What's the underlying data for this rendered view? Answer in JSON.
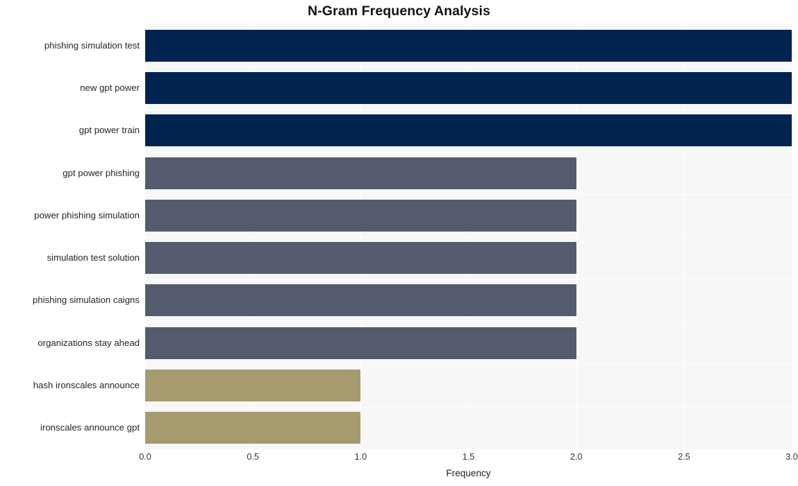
{
  "chart_data": {
    "type": "bar",
    "orientation": "horizontal",
    "title": "N-Gram Frequency Analysis",
    "xlabel": "Frequency",
    "ylabel": "",
    "categories": [
      "phishing simulation test",
      "new gpt power",
      "gpt power train",
      "gpt power phishing",
      "power phishing simulation",
      "simulation test solution",
      "phishing simulation caigns",
      "organizations stay ahead",
      "hash ironscales announce",
      "ironscales announce gpt"
    ],
    "values": [
      3,
      3,
      3,
      2,
      2,
      2,
      2,
      2,
      1,
      1
    ],
    "bar_colors": [
      "#012450",
      "#012450",
      "#012450",
      "#555b6e",
      "#555b6e",
      "#555b6e",
      "#555b6e",
      "#555b6e",
      "#a69a6f",
      "#a69a6f"
    ],
    "xlim": [
      0.0,
      3.0
    ],
    "xticks": [
      0.0,
      0.5,
      1.0,
      1.5,
      2.0,
      2.5,
      3.0
    ],
    "xticklabels": [
      "0.0",
      "0.5",
      "1.0",
      "1.5",
      "2.0",
      "2.5",
      "3.0"
    ],
    "grid": true,
    "grid_color": "#ffffff",
    "plot_background": "#f7f7f8",
    "figure_background": "#ffffff",
    "legend": null
  }
}
